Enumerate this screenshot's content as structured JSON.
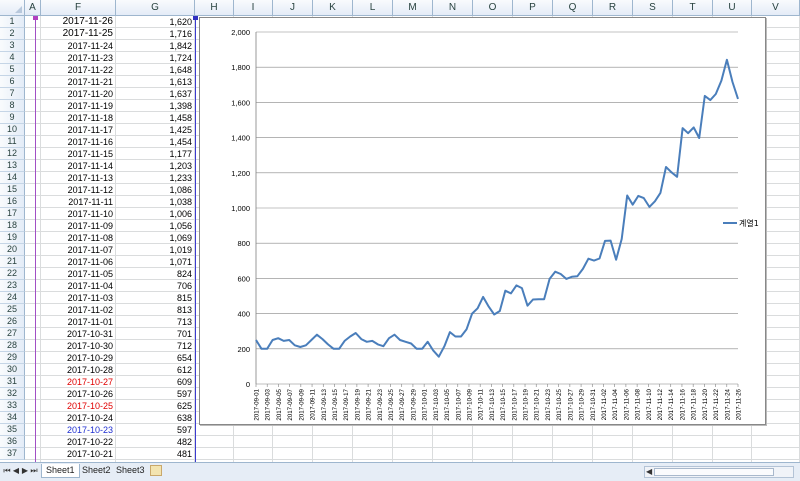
{
  "sheet": {
    "columns": [
      "A",
      "F",
      "G",
      "H",
      "I",
      "J",
      "K",
      "L",
      "M",
      "N",
      "O",
      "P",
      "Q",
      "R",
      "S",
      "T",
      "U",
      "V"
    ],
    "rows": [
      {
        "n": "1",
        "date": "2017-11-26",
        "value": "1,620",
        "style": "big"
      },
      {
        "n": "2",
        "date": "2017-11-25",
        "value": "1,716",
        "style": "big"
      },
      {
        "n": "3",
        "date": "2017-11-24",
        "value": "1,842",
        "style": ""
      },
      {
        "n": "4",
        "date": "2017-11-23",
        "value": "1,724",
        "style": ""
      },
      {
        "n": "5",
        "date": "2017-11-22",
        "value": "1,648",
        "style": ""
      },
      {
        "n": "6",
        "date": "2017-11-21",
        "value": "1,613",
        "style": ""
      },
      {
        "n": "7",
        "date": "2017-11-20",
        "value": "1,637",
        "style": ""
      },
      {
        "n": "8",
        "date": "2017-11-19",
        "value": "1,398",
        "style": ""
      },
      {
        "n": "9",
        "date": "2017-11-18",
        "value": "1,458",
        "style": ""
      },
      {
        "n": "10",
        "date": "2017-11-17",
        "value": "1,425",
        "style": ""
      },
      {
        "n": "11",
        "date": "2017-11-16",
        "value": "1,454",
        "style": ""
      },
      {
        "n": "12",
        "date": "2017-11-15",
        "value": "1,177",
        "style": ""
      },
      {
        "n": "13",
        "date": "2017-11-14",
        "value": "1,203",
        "style": ""
      },
      {
        "n": "14",
        "date": "2017-11-13",
        "value": "1,233",
        "style": ""
      },
      {
        "n": "15",
        "date": "2017-11-12",
        "value": "1,086",
        "style": ""
      },
      {
        "n": "16",
        "date": "2017-11-11",
        "value": "1,038",
        "style": ""
      },
      {
        "n": "17",
        "date": "2017-11-10",
        "value": "1,006",
        "style": ""
      },
      {
        "n": "18",
        "date": "2017-11-09",
        "value": "1,056",
        "style": ""
      },
      {
        "n": "19",
        "date": "2017-11-08",
        "value": "1,069",
        "style": ""
      },
      {
        "n": "20",
        "date": "2017-11-07",
        "value": "1,019",
        "style": ""
      },
      {
        "n": "21",
        "date": "2017-11-06",
        "value": "1,071",
        "style": ""
      },
      {
        "n": "22",
        "date": "2017-11-05",
        "value": "824",
        "style": ""
      },
      {
        "n": "23",
        "date": "2017-11-04",
        "value": "706",
        "style": ""
      },
      {
        "n": "24",
        "date": "2017-11-03",
        "value": "815",
        "style": ""
      },
      {
        "n": "25",
        "date": "2017-11-02",
        "value": "813",
        "style": ""
      },
      {
        "n": "26",
        "date": "2017-11-01",
        "value": "713",
        "style": ""
      },
      {
        "n": "27",
        "date": "2017-10-31",
        "value": "701",
        "style": ""
      },
      {
        "n": "28",
        "date": "2017-10-30",
        "value": "712",
        "style": ""
      },
      {
        "n": "29",
        "date": "2017-10-29",
        "value": "654",
        "style": ""
      },
      {
        "n": "30",
        "date": "2017-10-28",
        "value": "612",
        "style": ""
      },
      {
        "n": "31",
        "date": "2017-10-27",
        "value": "609",
        "style": "red"
      },
      {
        "n": "32",
        "date": "2017-10-26",
        "value": "597",
        "style": ""
      },
      {
        "n": "33",
        "date": "2017-10-25",
        "value": "625",
        "style": "red"
      },
      {
        "n": "34",
        "date": "2017-10-24",
        "value": "638",
        "style": ""
      },
      {
        "n": "35",
        "date": "2017-10-23",
        "value": "597",
        "style": "blue"
      },
      {
        "n": "36",
        "date": "2017-10-22",
        "value": "482",
        "style": ""
      },
      {
        "n": "37",
        "date": "2017-10-21",
        "value": "481",
        "style": ""
      }
    ]
  },
  "tabs": [
    "Sheet1",
    "Sheet2",
    "Sheet3"
  ],
  "colors": {
    "series": "#4a7ebb",
    "grid": "#878787",
    "text": "#000000"
  },
  "chart_data": {
    "type": "line",
    "title": "",
    "xlabel": "",
    "ylabel": "",
    "ylim": [
      0,
      2000
    ],
    "yticks": [
      "0",
      "200",
      "400",
      "600",
      "800",
      "1,000",
      "1,200",
      "1,400",
      "1,600",
      "1,800",
      "2,000"
    ],
    "grid": true,
    "legend_position": "right",
    "x_tick_labels": [
      "2017-09-01",
      "2017-09-03",
      "2017-09-05",
      "2017-09-07",
      "2017-09-09",
      "2017-09-11",
      "2017-09-13",
      "2017-09-15",
      "2017-09-17",
      "2017-09-19",
      "2017-09-21",
      "2017-09-23",
      "2017-09-25",
      "2017-09-27",
      "2017-09-29",
      "2017-10-01",
      "2017-10-03",
      "2017-10-05",
      "2017-10-07",
      "2017-10-09",
      "2017-10-11",
      "2017-10-13",
      "2017-10-15",
      "2017-10-17",
      "2017-10-19",
      "2017-10-21",
      "2017-10-23",
      "2017-10-25",
      "2017-10-27",
      "2017-10-29",
      "2017-10-31",
      "2017-11-02",
      "2017-11-04",
      "2017-11-06",
      "2017-11-08",
      "2017-11-10",
      "2017-11-12",
      "2017-11-14",
      "2017-11-16",
      "2017-11-18",
      "2017-11-20",
      "2017-11-22",
      "2017-11-24",
      "2017-11-26"
    ],
    "x_start": "2017-09-01",
    "x_end": "2017-11-26",
    "series": [
      {
        "name": "계열1",
        "values": [
          250,
          200,
          200,
          250,
          260,
          245,
          250,
          220,
          210,
          220,
          250,
          280,
          255,
          225,
          200,
          200,
          245,
          270,
          290,
          255,
          240,
          245,
          225,
          215,
          260,
          280,
          250,
          240,
          230,
          200,
          200,
          240,
          190,
          155,
          215,
          295,
          270,
          270,
          310,
          400,
          430,
          495,
          440,
          395,
          415,
          530,
          515,
          560,
          545,
          445,
          480,
          481,
          482,
          597,
          638,
          625,
          597,
          609,
          612,
          654,
          712,
          701,
          713,
          813,
          815,
          706,
          824,
          1071,
          1019,
          1069,
          1056,
          1006,
          1038,
          1086,
          1233,
          1203,
          1177,
          1454,
          1425,
          1458,
          1398,
          1637,
          1613,
          1648,
          1724,
          1842,
          1716,
          1620
        ]
      }
    ]
  }
}
